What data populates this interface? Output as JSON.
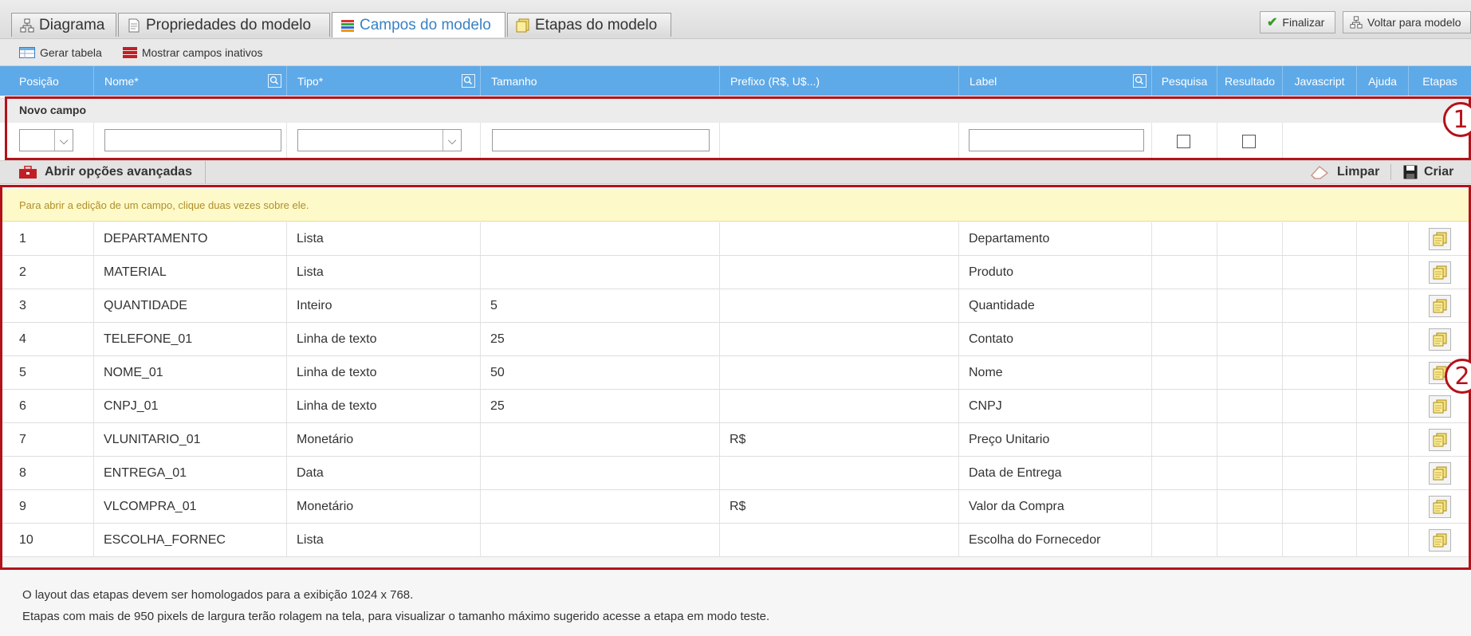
{
  "tabs": [
    {
      "label": "Diagrama",
      "icon": "diagram-icon"
    },
    {
      "label": "Propriedades do modelo",
      "icon": "document-icon"
    },
    {
      "label": "Campos do modelo",
      "icon": "fields-icon"
    },
    {
      "label": "Etapas do modelo",
      "icon": "steps-icon"
    }
  ],
  "top_actions": {
    "finalize": "Finalizar",
    "back": "Voltar para modelo"
  },
  "toolbar": {
    "generate_table": "Gerar tabela",
    "show_inactive": "Mostrar campos inativos"
  },
  "columns": [
    "Posição",
    "Nome*",
    "Tipo*",
    "Tamanho",
    "Prefixo (R$, U$...)",
    "Label",
    "Pesquisa",
    "Resultado",
    "Javascript",
    "Ajuda",
    "Etapas"
  ],
  "new_field": {
    "title": "Novo campo"
  },
  "advanced": {
    "open_label": "Abrir opções avançadas",
    "clear_label": "Limpar",
    "create_label": "Criar"
  },
  "notice": "Para abrir a edição de um campo, clique duas vezes sobre ele.",
  "rows": [
    {
      "pos": "1",
      "name": "DEPARTAMENTO",
      "type": "Lista",
      "size": "",
      "prefix": "",
      "label": "Departamento"
    },
    {
      "pos": "2",
      "name": "MATERIAL",
      "type": "Lista",
      "size": "",
      "prefix": "",
      "label": "Produto"
    },
    {
      "pos": "3",
      "name": "QUANTIDADE",
      "type": "Inteiro",
      "size": "5",
      "prefix": "",
      "label": "Quantidade"
    },
    {
      "pos": "4",
      "name": "TELEFONE_01",
      "type": "Linha de texto",
      "size": "25",
      "prefix": "",
      "label": "Contato"
    },
    {
      "pos": "5",
      "name": "NOME_01",
      "type": "Linha de texto",
      "size": "50",
      "prefix": "",
      "label": "Nome"
    },
    {
      "pos": "6",
      "name": "CNPJ_01",
      "type": "Linha de texto",
      "size": "25",
      "prefix": "",
      "label": "CNPJ"
    },
    {
      "pos": "7",
      "name": "VLUNITARIO_01",
      "type": "Monetário",
      "size": "",
      "prefix": "R$",
      "label": "Preço Unitario"
    },
    {
      "pos": "8",
      "name": "ENTREGA_01",
      "type": "Data",
      "size": "",
      "prefix": "",
      "label": "Data de Entrega"
    },
    {
      "pos": "9",
      "name": "VLCOMPRA_01",
      "type": "Monetário",
      "size": "",
      "prefix": "R$",
      "label": "Valor da Compra"
    },
    {
      "pos": "10",
      "name": "ESCOLHA_FORNEC",
      "type": "Lista",
      "size": "",
      "prefix": "",
      "label": "Escolha do Fornecedor"
    }
  ],
  "annotations": {
    "one": "1",
    "two": "2"
  },
  "footer": {
    "line1": "O layout das etapas devem ser homologados para a exibição 1024 x 768.",
    "line2": "Etapas com mais de 950 pixels de largura terão rolagem na tela, para visualizar o tamanho máximo sugerido acesse a etapa em modo teste."
  },
  "colors": {
    "header": "#5ea9e8",
    "accent_red": "#b3121a",
    "notice_bg": "#fdf9c8",
    "active_tab_text": "#3a82c4"
  }
}
